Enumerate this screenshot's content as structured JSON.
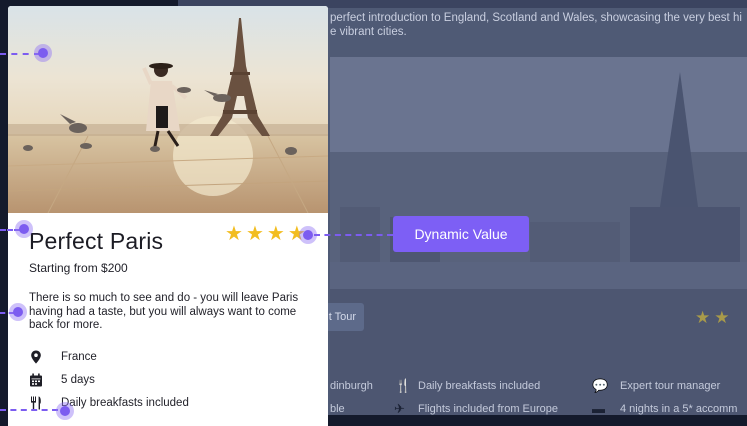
{
  "background": {
    "intro_line_1": "perfect introduction to England, Scotland and Wales, showcasing the very best hi",
    "intro_line_2": "e vibrant cities.",
    "button_label": "t Tour",
    "stars": 2,
    "features": {
      "col1_row1": "dinburgh",
      "col1_row2": "ble",
      "col2_row1": "Daily breakfasts included",
      "col2_row2": "Flights included from Europe",
      "col3_row1": "Expert tour manager",
      "col3_row2": "4 nights in a 5* accomm"
    }
  },
  "card": {
    "title": "Perfect Paris",
    "price": "Starting from $200",
    "rating": 4,
    "description": "There is so much to see and do - you will leave Paris having had a taste, but you will always want to come back for more.",
    "features": [
      {
        "icon": "location-pin-icon",
        "label": "France"
      },
      {
        "icon": "calendar-icon",
        "label": "5 days"
      },
      {
        "icon": "fork-knife-icon",
        "label": "Daily breakfasts included"
      }
    ]
  },
  "annotation": {
    "tag_label": "Dynamic Value"
  },
  "colors": {
    "accent": "#7D5FF5",
    "star": "#F2BD20",
    "text": "#23232B"
  }
}
